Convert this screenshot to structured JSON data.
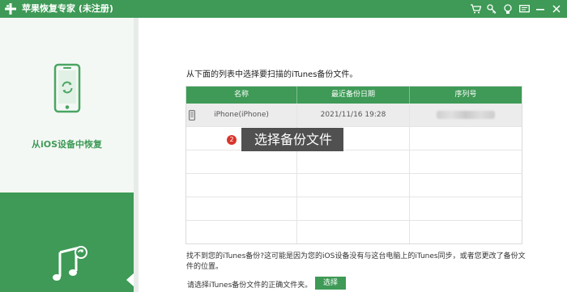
{
  "window": {
    "title": "苹果恢复专家 (未注册)",
    "icons": [
      "cart-icon",
      "key-icon",
      "lightbulb-icon",
      "message-icon",
      "minimize-icon",
      "close-icon"
    ]
  },
  "sidebar": {
    "mode_label": "从iOS设备中恢复"
  },
  "main": {
    "instruction": "从下面的列表中选择要扫描的iTunes备份文件。",
    "table": {
      "columns": [
        "名称",
        "最近备份日期",
        "序列号"
      ],
      "rows": [
        {
          "name": "iPhone(iPhone)",
          "date": "2021/11/16 19:28",
          "serial": ""
        }
      ]
    },
    "tooltip": {
      "step": "2",
      "text": "选择备份文件"
    },
    "note": "找不到您的iTunes备份?这可能是因为您的iOS设备没有与这台电脑上的iTunes同步，或者您更改了备份文件的位置。",
    "select_label": "请选择iTunes备份文件的正确文件夹。",
    "select_button": "选择"
  },
  "colors": {
    "accent": "#3e9a56",
    "badge": "#d9352b",
    "tooltip_bg": "#505050"
  }
}
